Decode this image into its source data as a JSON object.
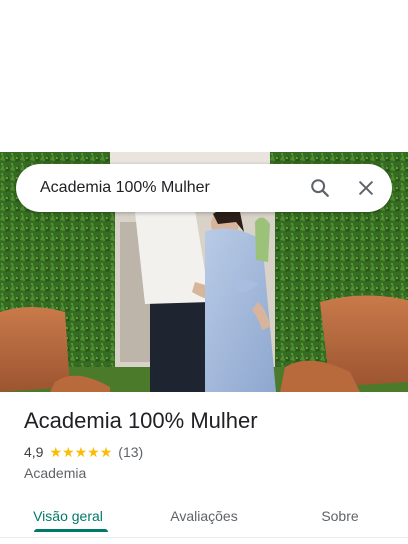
{
  "search": {
    "query": "Academia 100% Mulher"
  },
  "place": {
    "title": "Academia 100% Mulher",
    "rating": "4,9",
    "stars": 5,
    "review_count": "(13)",
    "category": "Academia"
  },
  "tabs": [
    {
      "label": "Visão geral",
      "active": true
    },
    {
      "label": "Avaliações",
      "active": false
    },
    {
      "label": "Sobre",
      "active": false
    }
  ],
  "colors": {
    "accent": "#00796b",
    "star": "#fbbc04"
  },
  "icons": {
    "search": "search-icon",
    "close": "close-icon",
    "star": "star-icon"
  }
}
